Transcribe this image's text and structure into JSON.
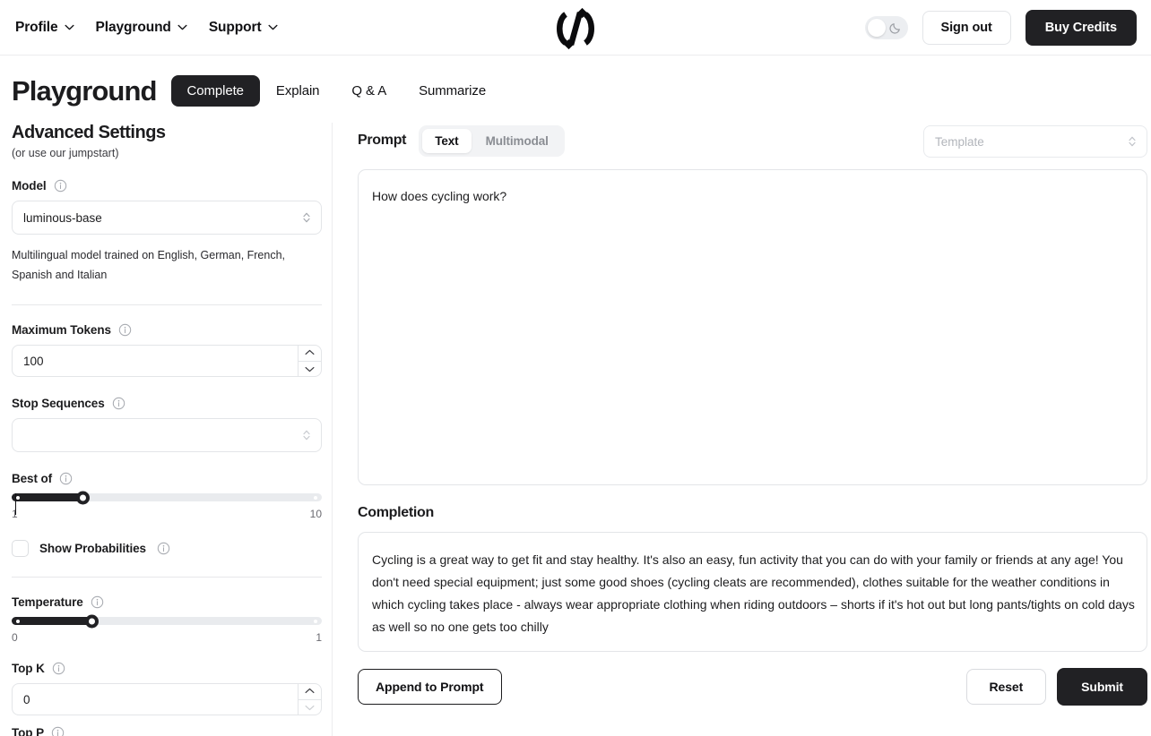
{
  "header": {
    "nav": [
      {
        "label": "Profile",
        "icon": "chevron-down-icon"
      },
      {
        "label": "Playground",
        "icon": "chevron-down-icon"
      },
      {
        "label": "Support",
        "icon": "chevron-down-icon"
      }
    ],
    "logo_name": "aleph-alpha-logo",
    "theme_toggle": {
      "state": "light",
      "icon": "moon-icon"
    },
    "sign_out_label": "Sign out",
    "buy_credits_label": "Buy Credits"
  },
  "page": {
    "title": "Playground",
    "tabs": [
      {
        "label": "Complete",
        "active": true
      },
      {
        "label": "Explain",
        "active": false
      },
      {
        "label": "Q & A",
        "active": false
      },
      {
        "label": "Summarize",
        "active": false
      }
    ]
  },
  "sidebar": {
    "title": "Advanced Settings",
    "subtitle": "(or use our jumpstart)",
    "model": {
      "label": "Model",
      "value": "luminous-base",
      "helper": "Multilingual model trained on English, German, French, Spanish and Italian"
    },
    "max_tokens": {
      "label": "Maximum Tokens",
      "value": "100"
    },
    "stop_sequences": {
      "label": "Stop Sequences",
      "value": ""
    },
    "best_of": {
      "label": "Best of",
      "min": "1",
      "max": "10",
      "value": 1,
      "percent": 23
    },
    "show_probabilities": {
      "label": "Show Probabilities",
      "checked": false
    },
    "temperature": {
      "label": "Temperature",
      "min": "0",
      "max": "1",
      "value": 0.26,
      "percent": 26
    },
    "top_k": {
      "label": "Top K",
      "value": "0"
    },
    "top_p": {
      "label": "Top P"
    }
  },
  "main": {
    "prompt_label": "Prompt",
    "modes": [
      {
        "label": "Text",
        "active": true
      },
      {
        "label": "Multimodal",
        "active": false
      }
    ],
    "template": {
      "placeholder": "Template",
      "value": ""
    },
    "prompt_text": "How does cycling work?",
    "completion_label": "Completion",
    "completion_text": "Cycling is a great way to get fit and stay healthy. It's also an easy, fun activity that you can do with your family or friends at any age! You don't need special equipment; just some good shoes (cycling cleats are recommended), clothes suitable for the weather conditions in which cycling takes place - always wear appropriate clothing when riding outdoors – shorts if it's hot out but long pants/tights on cold days as well so no one gets too chilly",
    "append_label": "Append to Prompt",
    "reset_label": "Reset",
    "submit_label": "Submit"
  },
  "colors": {
    "accent_dark": "#212124",
    "border": "#e3e5e8",
    "muted_text": "#6a6a70",
    "track": "#e9ebee"
  }
}
